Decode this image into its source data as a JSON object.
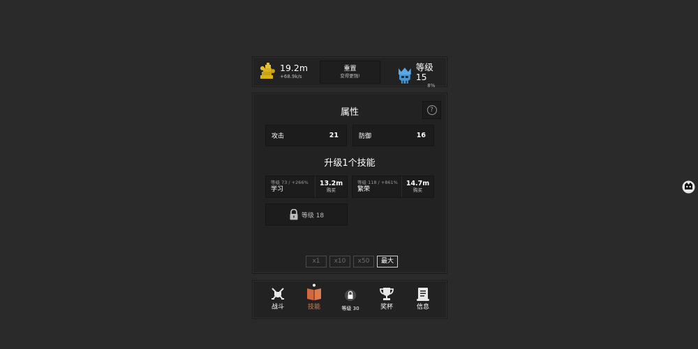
{
  "top": {
    "gold_value": "19.2m",
    "gold_rate": "+68.9k/s",
    "reset_label": "重置",
    "reset_sub": "变得更强!",
    "level_label": "等级 15",
    "level_progress": "8%"
  },
  "attributes": {
    "title": "属性",
    "help": "?",
    "attack_label": "攻击",
    "attack_value": "21",
    "defense_label": "防御",
    "defense_value": "16"
  },
  "skills": {
    "title": "升级1个技能",
    "items": [
      {
        "meta": "等级 73 / +266%",
        "name": "学习",
        "price": "13.2m",
        "buy": "购买"
      },
      {
        "meta": "等级 118 / +861%",
        "name": "繁荣",
        "price": "14.7m",
        "buy": "购买"
      }
    ],
    "locked_label": "等级 18"
  },
  "multipliers": [
    {
      "label": "x1",
      "active": false
    },
    {
      "label": "x10",
      "active": false
    },
    {
      "label": "x50",
      "active": false
    },
    {
      "label": "最大",
      "active": true
    }
  ],
  "nav": [
    {
      "label": "战斗",
      "icon": "crossed-swords-shield-icon"
    },
    {
      "label": "技能",
      "icon": "book-icon",
      "active": true
    },
    {
      "label": "等级 30",
      "icon": "lock-icon",
      "locked": true
    },
    {
      "label": "奖杯",
      "icon": "trophy-icon"
    },
    {
      "label": "信息",
      "icon": "scroll-icon"
    }
  ],
  "colors": {
    "background": "#2a2a2a",
    "panel": "#222222",
    "gold": "#d8b21a",
    "level_blue": "#5aa9e6",
    "active_tab": "#e07a4a"
  }
}
